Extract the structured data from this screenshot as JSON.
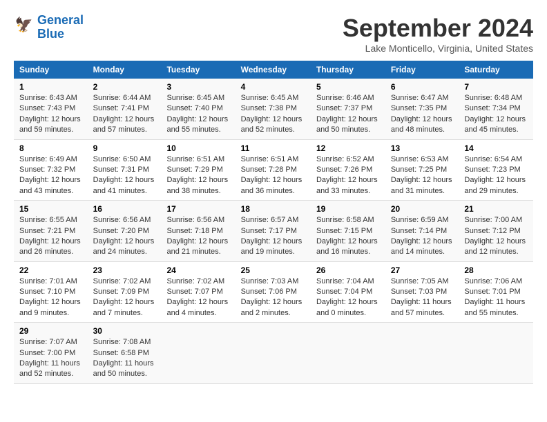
{
  "header": {
    "logo_line1": "General",
    "logo_line2": "Blue",
    "month_title": "September 2024",
    "location": "Lake Monticello, Virginia, United States"
  },
  "columns": [
    "Sunday",
    "Monday",
    "Tuesday",
    "Wednesday",
    "Thursday",
    "Friday",
    "Saturday"
  ],
  "weeks": [
    [
      {
        "day": "1",
        "sunrise": "Sunrise: 6:43 AM",
        "sunset": "Sunset: 7:43 PM",
        "daylight": "Daylight: 12 hours and 59 minutes."
      },
      {
        "day": "2",
        "sunrise": "Sunrise: 6:44 AM",
        "sunset": "Sunset: 7:41 PM",
        "daylight": "Daylight: 12 hours and 57 minutes."
      },
      {
        "day": "3",
        "sunrise": "Sunrise: 6:45 AM",
        "sunset": "Sunset: 7:40 PM",
        "daylight": "Daylight: 12 hours and 55 minutes."
      },
      {
        "day": "4",
        "sunrise": "Sunrise: 6:45 AM",
        "sunset": "Sunset: 7:38 PM",
        "daylight": "Daylight: 12 hours and 52 minutes."
      },
      {
        "day": "5",
        "sunrise": "Sunrise: 6:46 AM",
        "sunset": "Sunset: 7:37 PM",
        "daylight": "Daylight: 12 hours and 50 minutes."
      },
      {
        "day": "6",
        "sunrise": "Sunrise: 6:47 AM",
        "sunset": "Sunset: 7:35 PM",
        "daylight": "Daylight: 12 hours and 48 minutes."
      },
      {
        "day": "7",
        "sunrise": "Sunrise: 6:48 AM",
        "sunset": "Sunset: 7:34 PM",
        "daylight": "Daylight: 12 hours and 45 minutes."
      }
    ],
    [
      {
        "day": "8",
        "sunrise": "Sunrise: 6:49 AM",
        "sunset": "Sunset: 7:32 PM",
        "daylight": "Daylight: 12 hours and 43 minutes."
      },
      {
        "day": "9",
        "sunrise": "Sunrise: 6:50 AM",
        "sunset": "Sunset: 7:31 PM",
        "daylight": "Daylight: 12 hours and 41 minutes."
      },
      {
        "day": "10",
        "sunrise": "Sunrise: 6:51 AM",
        "sunset": "Sunset: 7:29 PM",
        "daylight": "Daylight: 12 hours and 38 minutes."
      },
      {
        "day": "11",
        "sunrise": "Sunrise: 6:51 AM",
        "sunset": "Sunset: 7:28 PM",
        "daylight": "Daylight: 12 hours and 36 minutes."
      },
      {
        "day": "12",
        "sunrise": "Sunrise: 6:52 AM",
        "sunset": "Sunset: 7:26 PM",
        "daylight": "Daylight: 12 hours and 33 minutes."
      },
      {
        "day": "13",
        "sunrise": "Sunrise: 6:53 AM",
        "sunset": "Sunset: 7:25 PM",
        "daylight": "Daylight: 12 hours and 31 minutes."
      },
      {
        "day": "14",
        "sunrise": "Sunrise: 6:54 AM",
        "sunset": "Sunset: 7:23 PM",
        "daylight": "Daylight: 12 hours and 29 minutes."
      }
    ],
    [
      {
        "day": "15",
        "sunrise": "Sunrise: 6:55 AM",
        "sunset": "Sunset: 7:21 PM",
        "daylight": "Daylight: 12 hours and 26 minutes."
      },
      {
        "day": "16",
        "sunrise": "Sunrise: 6:56 AM",
        "sunset": "Sunset: 7:20 PM",
        "daylight": "Daylight: 12 hours and 24 minutes."
      },
      {
        "day": "17",
        "sunrise": "Sunrise: 6:56 AM",
        "sunset": "Sunset: 7:18 PM",
        "daylight": "Daylight: 12 hours and 21 minutes."
      },
      {
        "day": "18",
        "sunrise": "Sunrise: 6:57 AM",
        "sunset": "Sunset: 7:17 PM",
        "daylight": "Daylight: 12 hours and 19 minutes."
      },
      {
        "day": "19",
        "sunrise": "Sunrise: 6:58 AM",
        "sunset": "Sunset: 7:15 PM",
        "daylight": "Daylight: 12 hours and 16 minutes."
      },
      {
        "day": "20",
        "sunrise": "Sunrise: 6:59 AM",
        "sunset": "Sunset: 7:14 PM",
        "daylight": "Daylight: 12 hours and 14 minutes."
      },
      {
        "day": "21",
        "sunrise": "Sunrise: 7:00 AM",
        "sunset": "Sunset: 7:12 PM",
        "daylight": "Daylight: 12 hours and 12 minutes."
      }
    ],
    [
      {
        "day": "22",
        "sunrise": "Sunrise: 7:01 AM",
        "sunset": "Sunset: 7:10 PM",
        "daylight": "Daylight: 12 hours and 9 minutes."
      },
      {
        "day": "23",
        "sunrise": "Sunrise: 7:02 AM",
        "sunset": "Sunset: 7:09 PM",
        "daylight": "Daylight: 12 hours and 7 minutes."
      },
      {
        "day": "24",
        "sunrise": "Sunrise: 7:02 AM",
        "sunset": "Sunset: 7:07 PM",
        "daylight": "Daylight: 12 hours and 4 minutes."
      },
      {
        "day": "25",
        "sunrise": "Sunrise: 7:03 AM",
        "sunset": "Sunset: 7:06 PM",
        "daylight": "Daylight: 12 hours and 2 minutes."
      },
      {
        "day": "26",
        "sunrise": "Sunrise: 7:04 AM",
        "sunset": "Sunset: 7:04 PM",
        "daylight": "Daylight: 12 hours and 0 minutes."
      },
      {
        "day": "27",
        "sunrise": "Sunrise: 7:05 AM",
        "sunset": "Sunset: 7:03 PM",
        "daylight": "Daylight: 11 hours and 57 minutes."
      },
      {
        "day": "28",
        "sunrise": "Sunrise: 7:06 AM",
        "sunset": "Sunset: 7:01 PM",
        "daylight": "Daylight: 11 hours and 55 minutes."
      }
    ],
    [
      {
        "day": "29",
        "sunrise": "Sunrise: 7:07 AM",
        "sunset": "Sunset: 7:00 PM",
        "daylight": "Daylight: 11 hours and 52 minutes."
      },
      {
        "day": "30",
        "sunrise": "Sunrise: 7:08 AM",
        "sunset": "Sunset: 6:58 PM",
        "daylight": "Daylight: 11 hours and 50 minutes."
      },
      null,
      null,
      null,
      null,
      null
    ]
  ]
}
